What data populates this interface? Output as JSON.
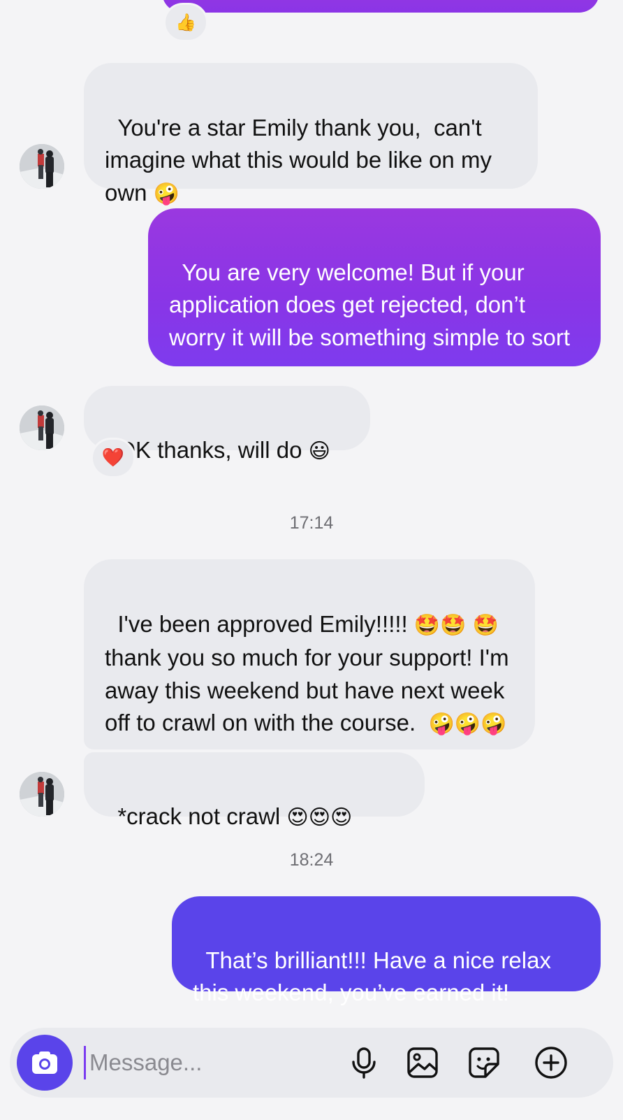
{
  "conversation": {
    "messages": [
      {
        "id": "m1",
        "text": "You're a star Emily thank you,  can't imagine what this would be like on my own",
        "emoji": "🤪"
      },
      {
        "id": "m2",
        "text": "You are very welcome! But if your application does get rejected, don’t worry it will be something simple to sort"
      },
      {
        "id": "m3",
        "text": "OK thanks, will do",
        "emoji": "😃",
        "reaction": "❤️"
      },
      {
        "id": "m4",
        "text_a": "I've been approved Emily!!!!!",
        "emoji_a": "🤩🤩",
        "emoji_b": "🤩",
        "text_b": " thank you so much for your support! I'm away this weekend but have next week off to crawl on with the course.  ",
        "emoji_c": "🤪🤪🤪"
      },
      {
        "id": "m5",
        "text": "*crack not crawl",
        "emoji": "😍😍😍"
      },
      {
        "id": "m6",
        "text": "That’s brilliant!!! Have a nice relax this weekend, you’ve earned it!"
      }
    ],
    "top_reaction": "👍",
    "timestamps": [
      "17:14",
      "18:24"
    ]
  },
  "composer": {
    "placeholder": "Message...",
    "value": ""
  },
  "icons": {
    "camera": "camera-icon",
    "microphone": "microphone-icon",
    "gallery": "gallery-icon",
    "sticker": "sticker-icon",
    "add": "add-icon"
  },
  "colors": {
    "outgoing_purple": "#8a35e6",
    "outgoing_indigo": "#5a44ea",
    "incoming_bubble": "#e9eaee",
    "background": "#f4f4f6"
  }
}
